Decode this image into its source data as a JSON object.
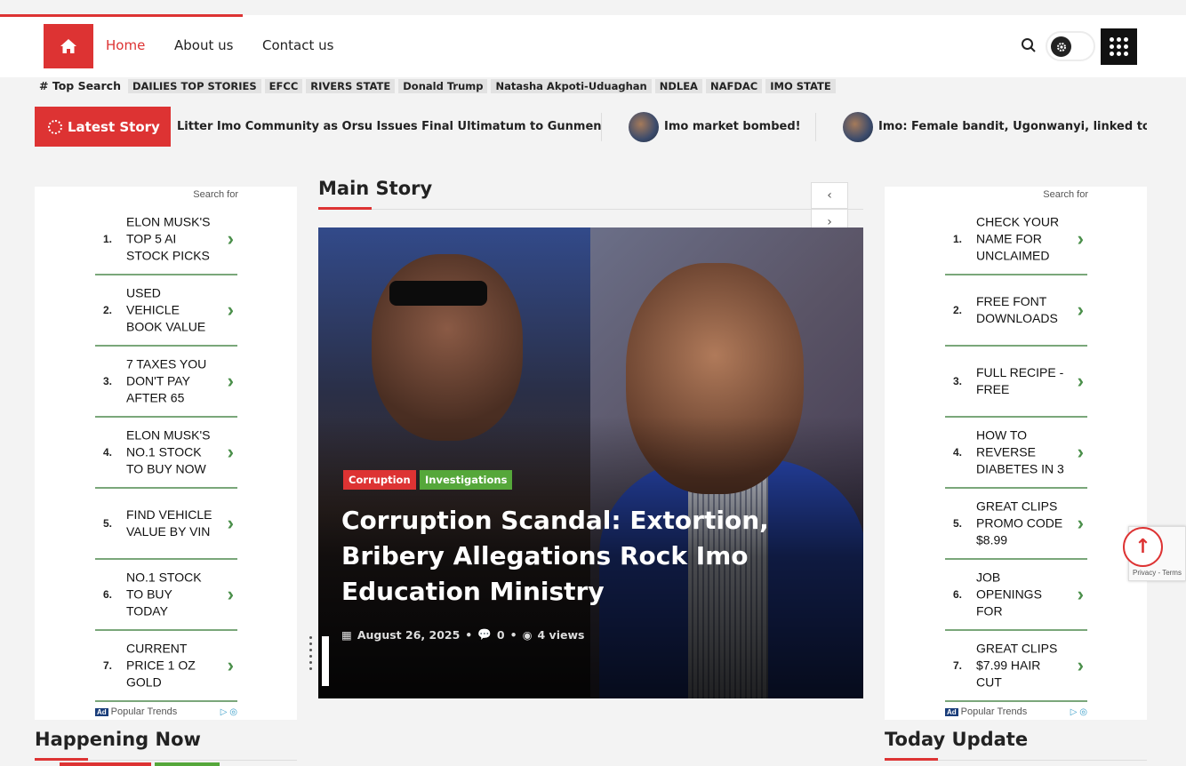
{
  "header": {
    "nav": [
      {
        "label": "Home",
        "active": true
      },
      {
        "label": "About us"
      },
      {
        "label": "Contact us"
      }
    ],
    "icons": {
      "home": "home-icon",
      "search": "search-icon",
      "theme": "gear-icon",
      "menu": "grid-menu-icon"
    }
  },
  "top_search": {
    "label": "# Top Search",
    "tags": [
      "DAILIES TOP STORIES",
      "EFCC",
      "RIVERS STATE",
      "Donald Trump",
      "Natasha Akpoti-Uduaghan",
      "NDLEA",
      "NAFDAC",
      "IMO STATE"
    ]
  },
  "latest_story": {
    "label": "Latest Story",
    "items": [
      "Litter Imo Community as Orsu Issues Final Ultimatum to Gunmen",
      "Imo market bombed!",
      "Imo: Female bandit, Ugonwanyi, linked to rit"
    ]
  },
  "ads_left": {
    "search_for": "Search for",
    "items": [
      {
        "num": "1.",
        "text": "ELON MUSK'S TOP 5 AI STOCK PICKS"
      },
      {
        "num": "2.",
        "text": "USED VEHICLE BOOK VALUE"
      },
      {
        "num": "3.",
        "text": "7 TAXES YOU DON'T PAY AFTER 65"
      },
      {
        "num": "4.",
        "text": "ELON MUSK'S NO.1 STOCK TO BUY NOW"
      },
      {
        "num": "5.",
        "text": "FIND VEHICLE VALUE BY VIN"
      },
      {
        "num": "6.",
        "text": "NO.1 STOCK TO BUY TODAY"
      },
      {
        "num": "7.",
        "text": "CURRENT PRICE 1 OZ GOLD"
      }
    ],
    "footer": "Popular Trends",
    "ad_badge": "Ad"
  },
  "ads_right": {
    "search_for": "Search for",
    "items": [
      {
        "num": "1.",
        "text": "CHECK YOUR NAME FOR UNCLAIMED"
      },
      {
        "num": "2.",
        "text": "FREE FONT DOWNLOADS"
      },
      {
        "num": "3.",
        "text": "FULL RECIPE - FREE"
      },
      {
        "num": "4.",
        "text": "HOW TO REVERSE DIABETES IN 3"
      },
      {
        "num": "5.",
        "text": "GREAT CLIPS PROMO CODE $8.99"
      },
      {
        "num": "6.",
        "text": "JOB OPENINGS FOR"
      },
      {
        "num": "7.",
        "text": "GREAT CLIPS $7.99 HAIR CUT"
      }
    ],
    "footer": "Popular Trends",
    "ad_badge": "Ad"
  },
  "main_story": {
    "section_title": "Main Story",
    "categories": [
      "Corruption",
      "Investigations"
    ],
    "headline": "Corruption Scandal: Extortion, Bribery Allegations Rock Imo Education Ministry",
    "date": "August 26, 2025",
    "comments": "0",
    "views": "4 views"
  },
  "sections": {
    "happening_now": "Happening Now",
    "today_update": "Today Update"
  },
  "recaptcha": {
    "text": "Privacy - Terms"
  },
  "colors": {
    "accent": "#dd3333",
    "green": "#55a73a"
  }
}
